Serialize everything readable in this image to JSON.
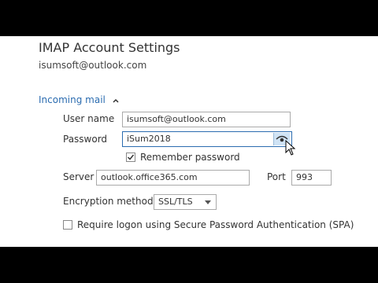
{
  "dialog": {
    "title": "IMAP Account Settings",
    "account_email": "isumsoft@outlook.com"
  },
  "incoming": {
    "section_label": "Incoming mail",
    "username_label": "User name",
    "username_value": "isumsoft@outlook.com",
    "password_label": "Password",
    "password_value": "iSum2018",
    "remember_label": "Remember password",
    "remember_checked": true,
    "server_label": "Server",
    "server_value": "outlook.office365.com",
    "port_label": "Port",
    "port_value": "993",
    "encryption_label": "Encryption method",
    "encryption_value": "SSL/TLS",
    "spa_label": "Require logon using Secure Password Authentication (SPA)",
    "spa_checked": false
  },
  "colors": {
    "accent": "#2b6cb0",
    "panel_bg": "#ffffff",
    "frame_bg": "#000000"
  }
}
